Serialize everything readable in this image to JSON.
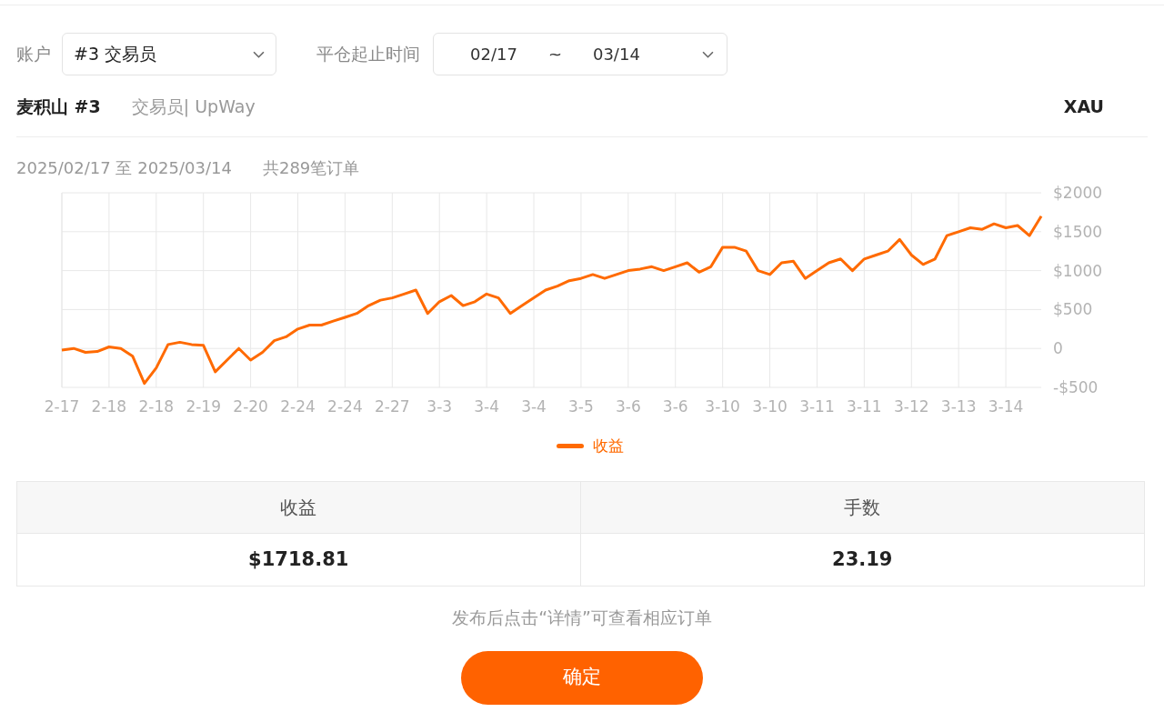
{
  "filters": {
    "account": {
      "label": "账户",
      "value": "#3 交易员"
    },
    "close_range": {
      "label": "平仓起止时间",
      "start": "02/17",
      "separator": "~",
      "end": "03/14"
    }
  },
  "header": {
    "name": "麦积山 #3",
    "subtitle": "交易员| UpWay",
    "symbol": "XAU"
  },
  "period": {
    "range": "2025/02/17 至 2025/03/14",
    "orders": "共289笔订单"
  },
  "chart_data": {
    "type": "line",
    "categories": [
      "2-17",
      null,
      null,
      null,
      "2-18",
      null,
      null,
      null,
      "2-18",
      null,
      null,
      null,
      "2-19",
      null,
      null,
      null,
      "2-20",
      null,
      null,
      null,
      "2-24",
      null,
      null,
      null,
      "2-24",
      null,
      null,
      null,
      "2-27",
      null,
      null,
      null,
      "3-3",
      null,
      null,
      null,
      "3-4",
      null,
      null,
      null,
      "3-4",
      null,
      null,
      null,
      "3-5",
      null,
      null,
      null,
      "3-6",
      null,
      null,
      null,
      "3-6",
      null,
      null,
      null,
      "3-10",
      null,
      null,
      null,
      "3-10",
      null,
      null,
      null,
      "3-11",
      null,
      null,
      null,
      "3-11",
      null,
      null,
      null,
      "3-12",
      null,
      null,
      null,
      "3-13",
      null,
      null,
      null,
      "3-14",
      null,
      null,
      null
    ],
    "series": [
      {
        "name": "收益",
        "color": "#ff6a00",
        "values": [
          -20,
          0,
          -50,
          -40,
          20,
          0,
          -100,
          -450,
          -250,
          50,
          80,
          50,
          40,
          -300,
          -150,
          0,
          -150,
          -50,
          100,
          150,
          250,
          300,
          300,
          350,
          400,
          450,
          550,
          620,
          650,
          700,
          750,
          450,
          600,
          680,
          550,
          600,
          700,
          650,
          450,
          550,
          650,
          750,
          800,
          870,
          900,
          950,
          900,
          950,
          1000,
          1020,
          1050,
          1000,
          1050,
          1100,
          980,
          1050,
          1300,
          1300,
          1250,
          1000,
          950,
          1100,
          1120,
          900,
          1000,
          1100,
          1150,
          1000,
          1150,
          1200,
          1250,
          1400,
          1200,
          1080,
          1150,
          1450,
          1500,
          1550,
          1530,
          1600,
          1550,
          1580,
          1450,
          1700
        ]
      }
    ],
    "grid": true,
    "ylim": [
      -500,
      2000
    ],
    "yticks": [
      {
        "value": 2000,
        "label": "$2000"
      },
      {
        "value": 1500,
        "label": "$1500"
      },
      {
        "value": 1000,
        "label": "$1000"
      },
      {
        "value": 500,
        "label": "$500"
      },
      {
        "value": 0,
        "label": "0"
      },
      {
        "value": -500,
        "label": "-$500"
      }
    ]
  },
  "summary": {
    "columns": [
      "收益",
      "手数"
    ],
    "values": [
      "$1718.81",
      "23.19"
    ]
  },
  "note": "发布后点击“详情”可查看相应订单",
  "confirm_button": "确定"
}
